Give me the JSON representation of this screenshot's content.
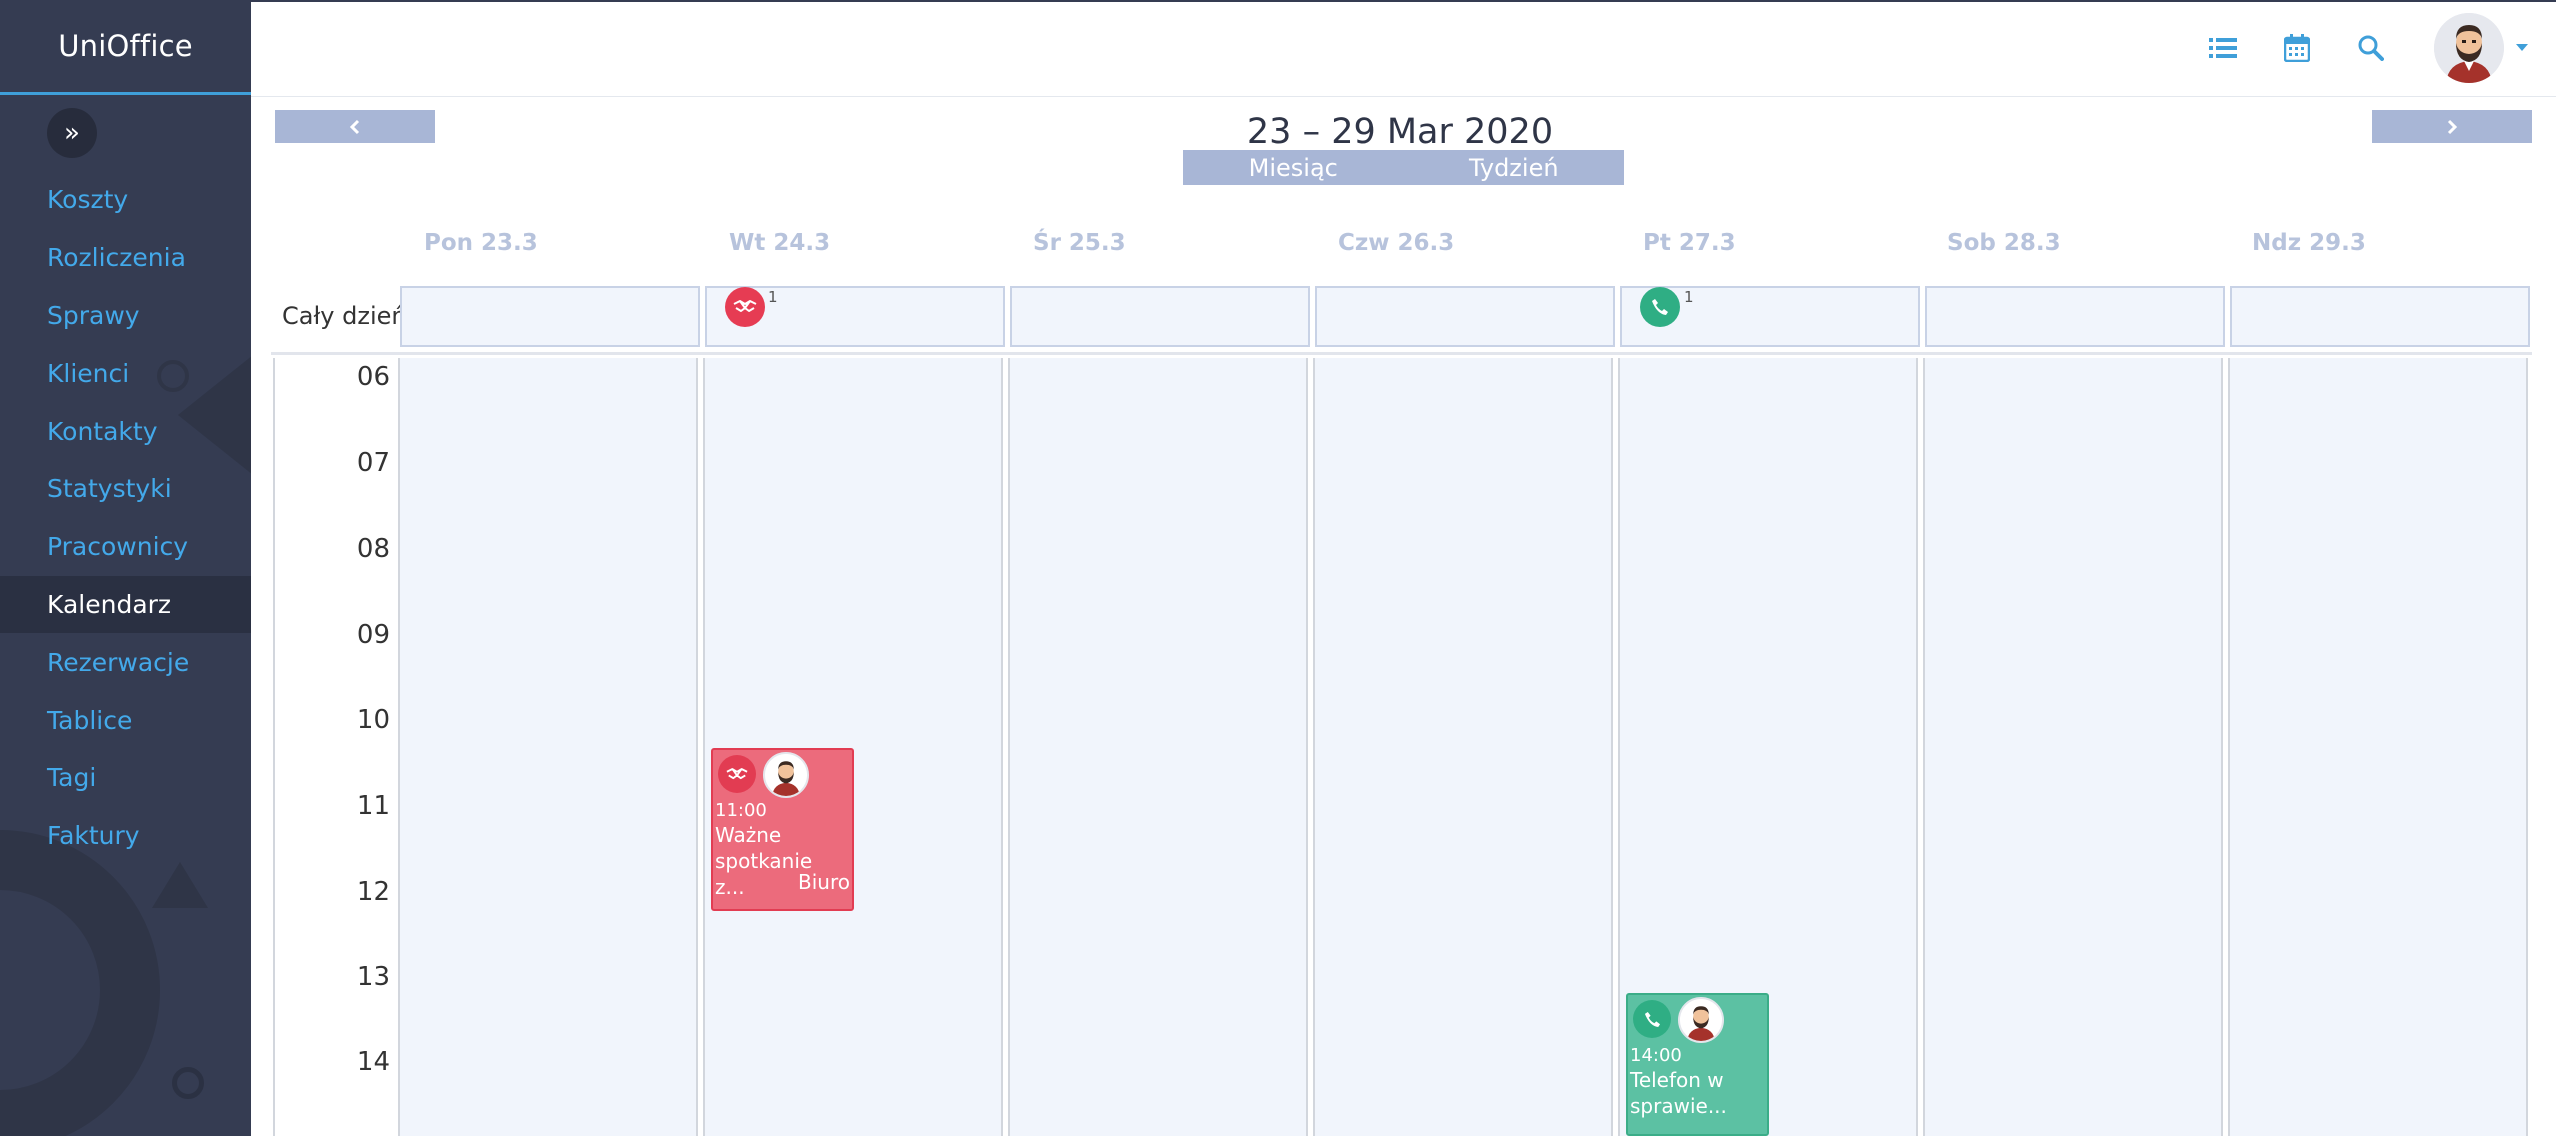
{
  "app": {
    "brand_main": "Uni",
    "brand_accent": "Office"
  },
  "sidebar": {
    "items": [
      {
        "label": "Koszty"
      },
      {
        "label": "Rozliczenia"
      },
      {
        "label": "Sprawy"
      },
      {
        "label": "Klienci"
      },
      {
        "label": "Kontakty"
      },
      {
        "label": "Statystyki"
      },
      {
        "label": "Pracownicy"
      },
      {
        "label": "Kalendarz",
        "active": true
      },
      {
        "label": "Rezerwacje"
      },
      {
        "label": "Tablice"
      },
      {
        "label": "Tagi"
      },
      {
        "label": "Faktury"
      }
    ]
  },
  "header": {
    "icons": [
      "list-icon",
      "calendar-icon",
      "search-icon"
    ],
    "accent_color": "#3f9fd9"
  },
  "calendar": {
    "title": "23 – 29 Mar 2020",
    "views": {
      "month": "Miesiąc",
      "week": "Tydzień"
    },
    "all_day_label": "Cały dzień",
    "days": [
      "Pon 23.3",
      "Wt 24.3",
      "Śr 25.3",
      "Czw 26.3",
      "Pt 27.3",
      "Sob 28.3",
      "Ndz 29.3"
    ],
    "hours": [
      "06",
      "07",
      "08",
      "09",
      "10",
      "11",
      "12",
      "13",
      "14"
    ],
    "all_day_badges": [
      {
        "day": "Wt 24.3",
        "type": "meeting-icon",
        "count": "1",
        "color": "#e63c53"
      },
      {
        "day": "Pt 27.3",
        "type": "phone-icon",
        "count": "1",
        "color": "#2fae84"
      }
    ],
    "events": [
      {
        "day": "Wt 24.3",
        "time": "11:00",
        "title": "Ważne spotkanie z...",
        "location": "Biuro",
        "type": "meeting-icon",
        "color": "#ec6b7c"
      },
      {
        "day": "Pt 27.3",
        "time": "14:00",
        "title": "Telefon w sprawie...",
        "location": "",
        "type": "phone-icon",
        "color": "#5cc1a3"
      }
    ]
  }
}
